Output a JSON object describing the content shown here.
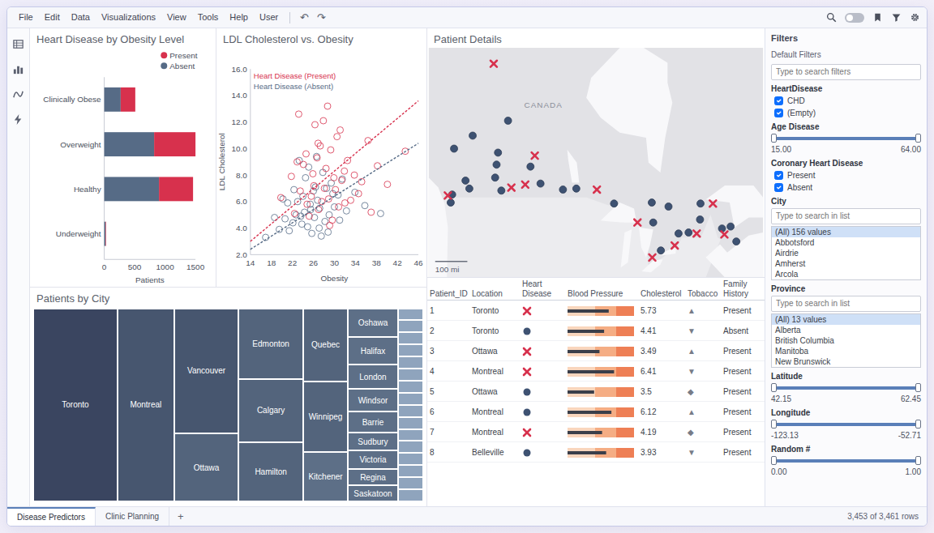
{
  "menu": {
    "items": [
      "File",
      "Edit",
      "Data",
      "Visualizations",
      "View",
      "Tools",
      "Help",
      "User"
    ],
    "undo": "↶",
    "redo": "↷"
  },
  "toolbar": {
    "toggle": {
      "on": false
    }
  },
  "bar_chart": {
    "title": "Heart Disease by Obesity Level",
    "categories": [
      "Clinically Obese",
      "Overweight",
      "Healthy",
      "Underweight"
    ],
    "series": [
      {
        "name": "Present",
        "color": "#d7314d",
        "values": [
          240,
          680,
          560,
          8
        ]
      },
      {
        "name": "Absent",
        "color": "#566b86",
        "values": [
          270,
          820,
          900,
          22
        ]
      }
    ],
    "x_ticks": [
      "0",
      "500",
      "1000",
      "1500"
    ],
    "x_title": "Patients"
  },
  "scatter": {
    "title": "LDL Cholesterol vs. Obesity",
    "x_title": "Obesity",
    "y_title": "LDL Cholesterol",
    "x_ticks": [
      "14",
      "18",
      "22",
      "26",
      "30",
      "34",
      "38",
      "42",
      "46"
    ],
    "y_ticks": [
      "2.0",
      "4.0",
      "6.0",
      "8.0",
      "10.0",
      "12.0",
      "14.0",
      "16.0"
    ],
    "series": [
      {
        "name": "Present",
        "color": "#d7314d",
        "trend": {
          "label": "Heart Disease (Present)",
          "x": [
            14,
            46
          ],
          "y": [
            3.0,
            13.6
          ]
        },
        "points": [
          [
            26.1,
            7.2
          ],
          [
            28.4,
            8.5
          ],
          [
            30.2,
            6.9
          ],
          [
            24.8,
            5.8
          ],
          [
            32.5,
            9.1
          ],
          [
            27.3,
            10.2
          ],
          [
            29.9,
            7.8
          ],
          [
            25.6,
            6.4
          ],
          [
            33.8,
            8.0
          ],
          [
            22.4,
            5.1
          ],
          [
            31.1,
            11.4
          ],
          [
            28.9,
            6.2
          ],
          [
            26.7,
            9.3
          ],
          [
            35.2,
            7.5
          ],
          [
            24.1,
            8.8
          ],
          [
            30.8,
            5.6
          ],
          [
            27.9,
            12.1
          ],
          [
            29.3,
            9.9
          ],
          [
            23.5,
            6.8
          ],
          [
            36.4,
            10.6
          ],
          [
            25.2,
            4.9
          ],
          [
            31.9,
            8.3
          ],
          [
            28.1,
            7.0
          ],
          [
            33.1,
            6.1
          ],
          [
            21.8,
            7.9
          ],
          [
            27.0,
            5.4
          ],
          [
            30.5,
            10.9
          ],
          [
            26.3,
            11.8
          ],
          [
            34.6,
            6.6
          ],
          [
            29.6,
            4.6
          ],
          [
            38.2,
            8.7
          ],
          [
            24.6,
            9.6
          ],
          [
            32.0,
            5.9
          ],
          [
            27.6,
            6.0
          ],
          [
            25.9,
            8.1
          ],
          [
            40.1,
            7.3
          ],
          [
            22.9,
            9.0
          ],
          [
            28.7,
            13.2
          ],
          [
            31.4,
            7.6
          ],
          [
            19.8,
            6.3
          ],
          [
            37.0,
            5.2
          ],
          [
            26.9,
            10.4
          ],
          [
            43.5,
            9.8
          ],
          [
            29.1,
            4.2
          ],
          [
            23.2,
            12.6
          ]
        ]
      },
      {
        "name": "Absent",
        "color": "#566b86",
        "trend": {
          "label": "Heart Disease (Absent)",
          "x": [
            14,
            46
          ],
          "y": [
            2.4,
            10.4
          ]
        },
        "points": [
          [
            24.3,
            5.2
          ],
          [
            26.8,
            6.1
          ],
          [
            22.1,
            4.4
          ],
          [
            28.5,
            7.0
          ],
          [
            25.4,
            5.8
          ],
          [
            30.7,
            6.5
          ],
          [
            23.6,
            4.9
          ],
          [
            27.2,
            5.5
          ],
          [
            21.4,
            3.8
          ],
          [
            29.4,
            7.4
          ],
          [
            26.0,
            6.8
          ],
          [
            24.9,
            4.1
          ],
          [
            32.3,
            5.3
          ],
          [
            20.6,
            4.7
          ],
          [
            27.8,
            8.2
          ],
          [
            23.0,
            6.0
          ],
          [
            25.7,
            3.6
          ],
          [
            31.5,
            7.7
          ],
          [
            22.7,
            5.0
          ],
          [
            28.2,
            4.5
          ],
          [
            19.5,
            3.9
          ],
          [
            26.4,
            7.1
          ],
          [
            24.0,
            6.4
          ],
          [
            30.0,
            5.6
          ],
          [
            21.1,
            5.9
          ],
          [
            27.5,
            3.4
          ],
          [
            33.9,
            6.7
          ],
          [
            25.1,
            8.6
          ],
          [
            23.8,
            4.3
          ],
          [
            29.0,
            5.0
          ],
          [
            18.6,
            4.8
          ],
          [
            26.6,
            9.4
          ],
          [
            35.8,
            5.7
          ],
          [
            22.3,
            6.9
          ],
          [
            28.8,
            3.7
          ],
          [
            24.5,
            7.8
          ],
          [
            31.0,
            4.6
          ],
          [
            20.2,
            6.2
          ],
          [
            27.1,
            4.0
          ],
          [
            25.5,
            5.4
          ],
          [
            16.9,
            3.3
          ],
          [
            29.7,
            6.6
          ],
          [
            23.3,
            9.1
          ],
          [
            38.8,
            5.1
          ],
          [
            26.2,
            4.8
          ]
        ]
      }
    ]
  },
  "map": {
    "title": "Patient Details",
    "country_label": "CANADA",
    "scale_label": "100 mi",
    "markers": [
      {
        "lon": -123.1,
        "lat": 49.3,
        "present": false
      },
      {
        "lon": -123.4,
        "lat": 48.5,
        "present": false
      },
      {
        "lon": -119.5,
        "lat": 49.9,
        "present": false
      },
      {
        "lon": -120.3,
        "lat": 50.7,
        "present": false
      },
      {
        "lon": -122.7,
        "lat": 53.9,
        "present": false
      },
      {
        "lon": -114.1,
        "lat": 51.0,
        "present": false
      },
      {
        "lon": -113.5,
        "lat": 53.5,
        "present": false
      },
      {
        "lon": -113.8,
        "lat": 52.3,
        "present": false
      },
      {
        "lon": -112.8,
        "lat": 49.7,
        "present": false
      },
      {
        "lon": -106.7,
        "lat": 52.1,
        "present": false
      },
      {
        "lon": -104.6,
        "lat": 50.4,
        "present": false
      },
      {
        "lon": -97.1,
        "lat": 49.9,
        "present": false
      },
      {
        "lon": -99.9,
        "lat": 49.8,
        "present": false
      },
      {
        "lon": -89.2,
        "lat": 48.4,
        "present": false
      },
      {
        "lon": -81.0,
        "lat": 46.5,
        "present": false
      },
      {
        "lon": -79.4,
        "lat": 43.7,
        "present": false
      },
      {
        "lon": -75.7,
        "lat": 45.4,
        "present": false
      },
      {
        "lon": -73.6,
        "lat": 45.5,
        "present": false
      },
      {
        "lon": -71.2,
        "lat": 46.8,
        "present": false
      },
      {
        "lon": -63.6,
        "lat": 44.6,
        "present": false
      },
      {
        "lon": -64.8,
        "lat": 46.1,
        "present": false
      },
      {
        "lon": -66.6,
        "lat": 45.9,
        "present": false
      },
      {
        "lon": -71.1,
        "lat": 48.4,
        "present": false
      },
      {
        "lon": -77.8,
        "lat": 48.1,
        "present": false
      },
      {
        "lon": -111.4,
        "lat": 56.7,
        "present": false
      },
      {
        "lon": -118.8,
        "lat": 55.2,
        "present": false
      },
      {
        "lon": -81.3,
        "lat": 48.5,
        "present": false
      },
      {
        "lon": -114.4,
        "lat": 62.4,
        "present": true
      },
      {
        "lon": -124.0,
        "lat": 49.2,
        "present": true
      },
      {
        "lon": -105.8,
        "lat": 53.2,
        "present": true
      },
      {
        "lon": -107.8,
        "lat": 50.3,
        "present": true
      },
      {
        "lon": -110.7,
        "lat": 50.0,
        "present": true
      },
      {
        "lon": -92.8,
        "lat": 49.8,
        "present": true
      },
      {
        "lon": -84.3,
        "lat": 46.5,
        "present": true
      },
      {
        "lon": -81.2,
        "lat": 43.0,
        "present": true
      },
      {
        "lon": -76.5,
        "lat": 44.2,
        "present": true
      },
      {
        "lon": -71.9,
        "lat": 45.4,
        "present": true
      },
      {
        "lon": -68.5,
        "lat": 48.4,
        "present": true
      },
      {
        "lon": -66.1,
        "lat": 45.3,
        "present": true
      }
    ]
  },
  "table": {
    "columns": [
      "Patient_ID",
      "Location",
      "Heart Disease",
      "Blood Pressure",
      "Cholesterol",
      "Tobacco",
      "Family History"
    ],
    "rows": [
      {
        "id": "1",
        "location": "Toronto",
        "heart_disease": true,
        "bp_level": 0.62,
        "cholesterol": "5.73",
        "tobacco": "▲",
        "family_history": "Present"
      },
      {
        "id": "2",
        "location": "Toronto",
        "heart_disease": false,
        "bp_level": 0.55,
        "cholesterol": "4.41",
        "tobacco": "▼",
        "family_history": "Absent"
      },
      {
        "id": "3",
        "location": "Ottawa",
        "heart_disease": true,
        "bp_level": 0.48,
        "cholesterol": "3.49",
        "tobacco": "▲",
        "family_history": "Present"
      },
      {
        "id": "4",
        "location": "Montreal",
        "heart_disease": true,
        "bp_level": 0.7,
        "cholesterol": "6.41",
        "tobacco": "▼",
        "family_history": "Present"
      },
      {
        "id": "5",
        "location": "Ottawa",
        "heart_disease": false,
        "bp_level": 0.4,
        "cholesterol": "3.5",
        "tobacco": "◆",
        "family_history": "Present"
      },
      {
        "id": "6",
        "location": "Montreal",
        "heart_disease": false,
        "bp_level": 0.66,
        "cholesterol": "6.12",
        "tobacco": "▲",
        "family_history": "Present"
      },
      {
        "id": "7",
        "location": "Montreal",
        "heart_disease": true,
        "bp_level": 0.52,
        "cholesterol": "4.19",
        "tobacco": "◆",
        "family_history": "Present"
      },
      {
        "id": "8",
        "location": "Belleville",
        "heart_disease": false,
        "bp_level": 0.58,
        "cholesterol": "3.93",
        "tobacco": "▼",
        "family_history": "Present"
      }
    ]
  },
  "treemap": {
    "title": "Patients by City",
    "columns": [
      [
        {
          "label": "Toronto",
          "value": 640
        }
      ],
      [
        {
          "label": "Montreal",
          "value": 430
        }
      ],
      [
        {
          "label": "Vancouver",
          "value": 320
        },
        {
          "label": "Ottawa",
          "value": 170
        }
      ],
      [
        {
          "label": "Edmonton",
          "value": 180
        },
        {
          "label": "Calgary",
          "value": 160
        },
        {
          "label": "Hamilton",
          "value": 150
        }
      ],
      [
        {
          "label": "Quebec",
          "value": 130
        },
        {
          "label": "Winnipeg",
          "value": 125
        },
        {
          "label": "Kitchener",
          "value": 85
        }
      ],
      [
        {
          "label": "Oshawa",
          "value": 60
        },
        {
          "label": "Halifax",
          "value": 55
        },
        {
          "label": "London",
          "value": 50
        },
        {
          "label": "Windsor",
          "value": 45
        },
        {
          "label": "Barrie",
          "value": 40
        },
        {
          "label": "Sudbury",
          "value": 35
        },
        {
          "label": "Victoria",
          "value": 35
        },
        {
          "label": "Regina",
          "value": 30
        },
        {
          "label": "Saskatoon",
          "value": 30
        }
      ]
    ],
    "tail": [
      12,
      12,
      12,
      12,
      12,
      12,
      12,
      12,
      12,
      12,
      12,
      12,
      12,
      12,
      12,
      12
    ]
  },
  "filters": {
    "title": "Filters",
    "subtitle": "Default Filters",
    "search_placeholder": "Type to search filters",
    "groups": [
      {
        "kind": "checklist",
        "title": "HeartDisease",
        "items": [
          {
            "label": "CHD",
            "checked": true
          },
          {
            "label": "(Empty)",
            "checked": true
          }
        ]
      },
      {
        "kind": "range",
        "title": "Age Disease",
        "min": "15.00",
        "max": "64.00",
        "low": 0,
        "high": 1
      },
      {
        "kind": "checklist",
        "title": "Coronary Heart Disease",
        "items": [
          {
            "label": "Present",
            "checked": true
          },
          {
            "label": "Absent",
            "checked": true
          }
        ]
      },
      {
        "kind": "list",
        "title": "City",
        "placeholder": "Type to search in list",
        "items": [
          {
            "label": "(All) 156 values",
            "selected": true
          },
          {
            "label": "Abbotsford",
            "selected": false
          },
          {
            "label": "Airdrie",
            "selected": false
          },
          {
            "label": "Amherst",
            "selected": false
          },
          {
            "label": "Arcola",
            "selected": false
          }
        ]
      },
      {
        "kind": "list",
        "title": "Province",
        "placeholder": "Type to search in list",
        "items": [
          {
            "label": "(All) 13 values",
            "selected": true
          },
          {
            "label": "Alberta",
            "selected": false
          },
          {
            "label": "British Columbia",
            "selected": false
          },
          {
            "label": "Manitoba",
            "selected": false
          },
          {
            "label": "New Brunswick",
            "selected": false
          }
        ]
      },
      {
        "kind": "range",
        "title": "Latitude",
        "min": "42.15",
        "max": "62.45",
        "low": 0,
        "high": 1
      },
      {
        "kind": "range",
        "title": "Longitude",
        "min": "-123.13",
        "max": "-52.71",
        "low": 0,
        "high": 1
      },
      {
        "kind": "range",
        "title": "Random #",
        "min": "0.00",
        "max": "1.00",
        "low": 0,
        "high": 1
      }
    ]
  },
  "tabs": [
    {
      "label": "Disease Predictors",
      "selected": true
    },
    {
      "label": "Clinic Planning",
      "selected": false
    }
  ],
  "add_tab": "+",
  "status_bar": {
    "rows": "3,453 of 3,461 rows"
  }
}
